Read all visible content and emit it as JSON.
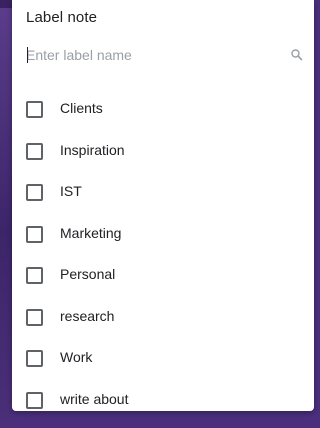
{
  "popup": {
    "title": "Label note",
    "search": {
      "placeholder": "Enter label name",
      "value": ""
    },
    "labels": [
      {
        "name": "Clients",
        "checked": false
      },
      {
        "name": "Inspiration",
        "checked": false
      },
      {
        "name": "IST",
        "checked": false
      },
      {
        "name": "Marketing",
        "checked": false
      },
      {
        "name": "Personal",
        "checked": false
      },
      {
        "name": "research",
        "checked": false
      },
      {
        "name": "Work",
        "checked": false
      },
      {
        "name": "write about",
        "checked": false
      }
    ]
  },
  "icons": {
    "search": "search-icon",
    "checkbox": "checkbox-unchecked"
  },
  "colors": {
    "background": "#4b2f7d",
    "panel": "#ffffff",
    "text": "#202124",
    "placeholder": "#9aa0a6",
    "checkbox_border": "#5f6368"
  }
}
